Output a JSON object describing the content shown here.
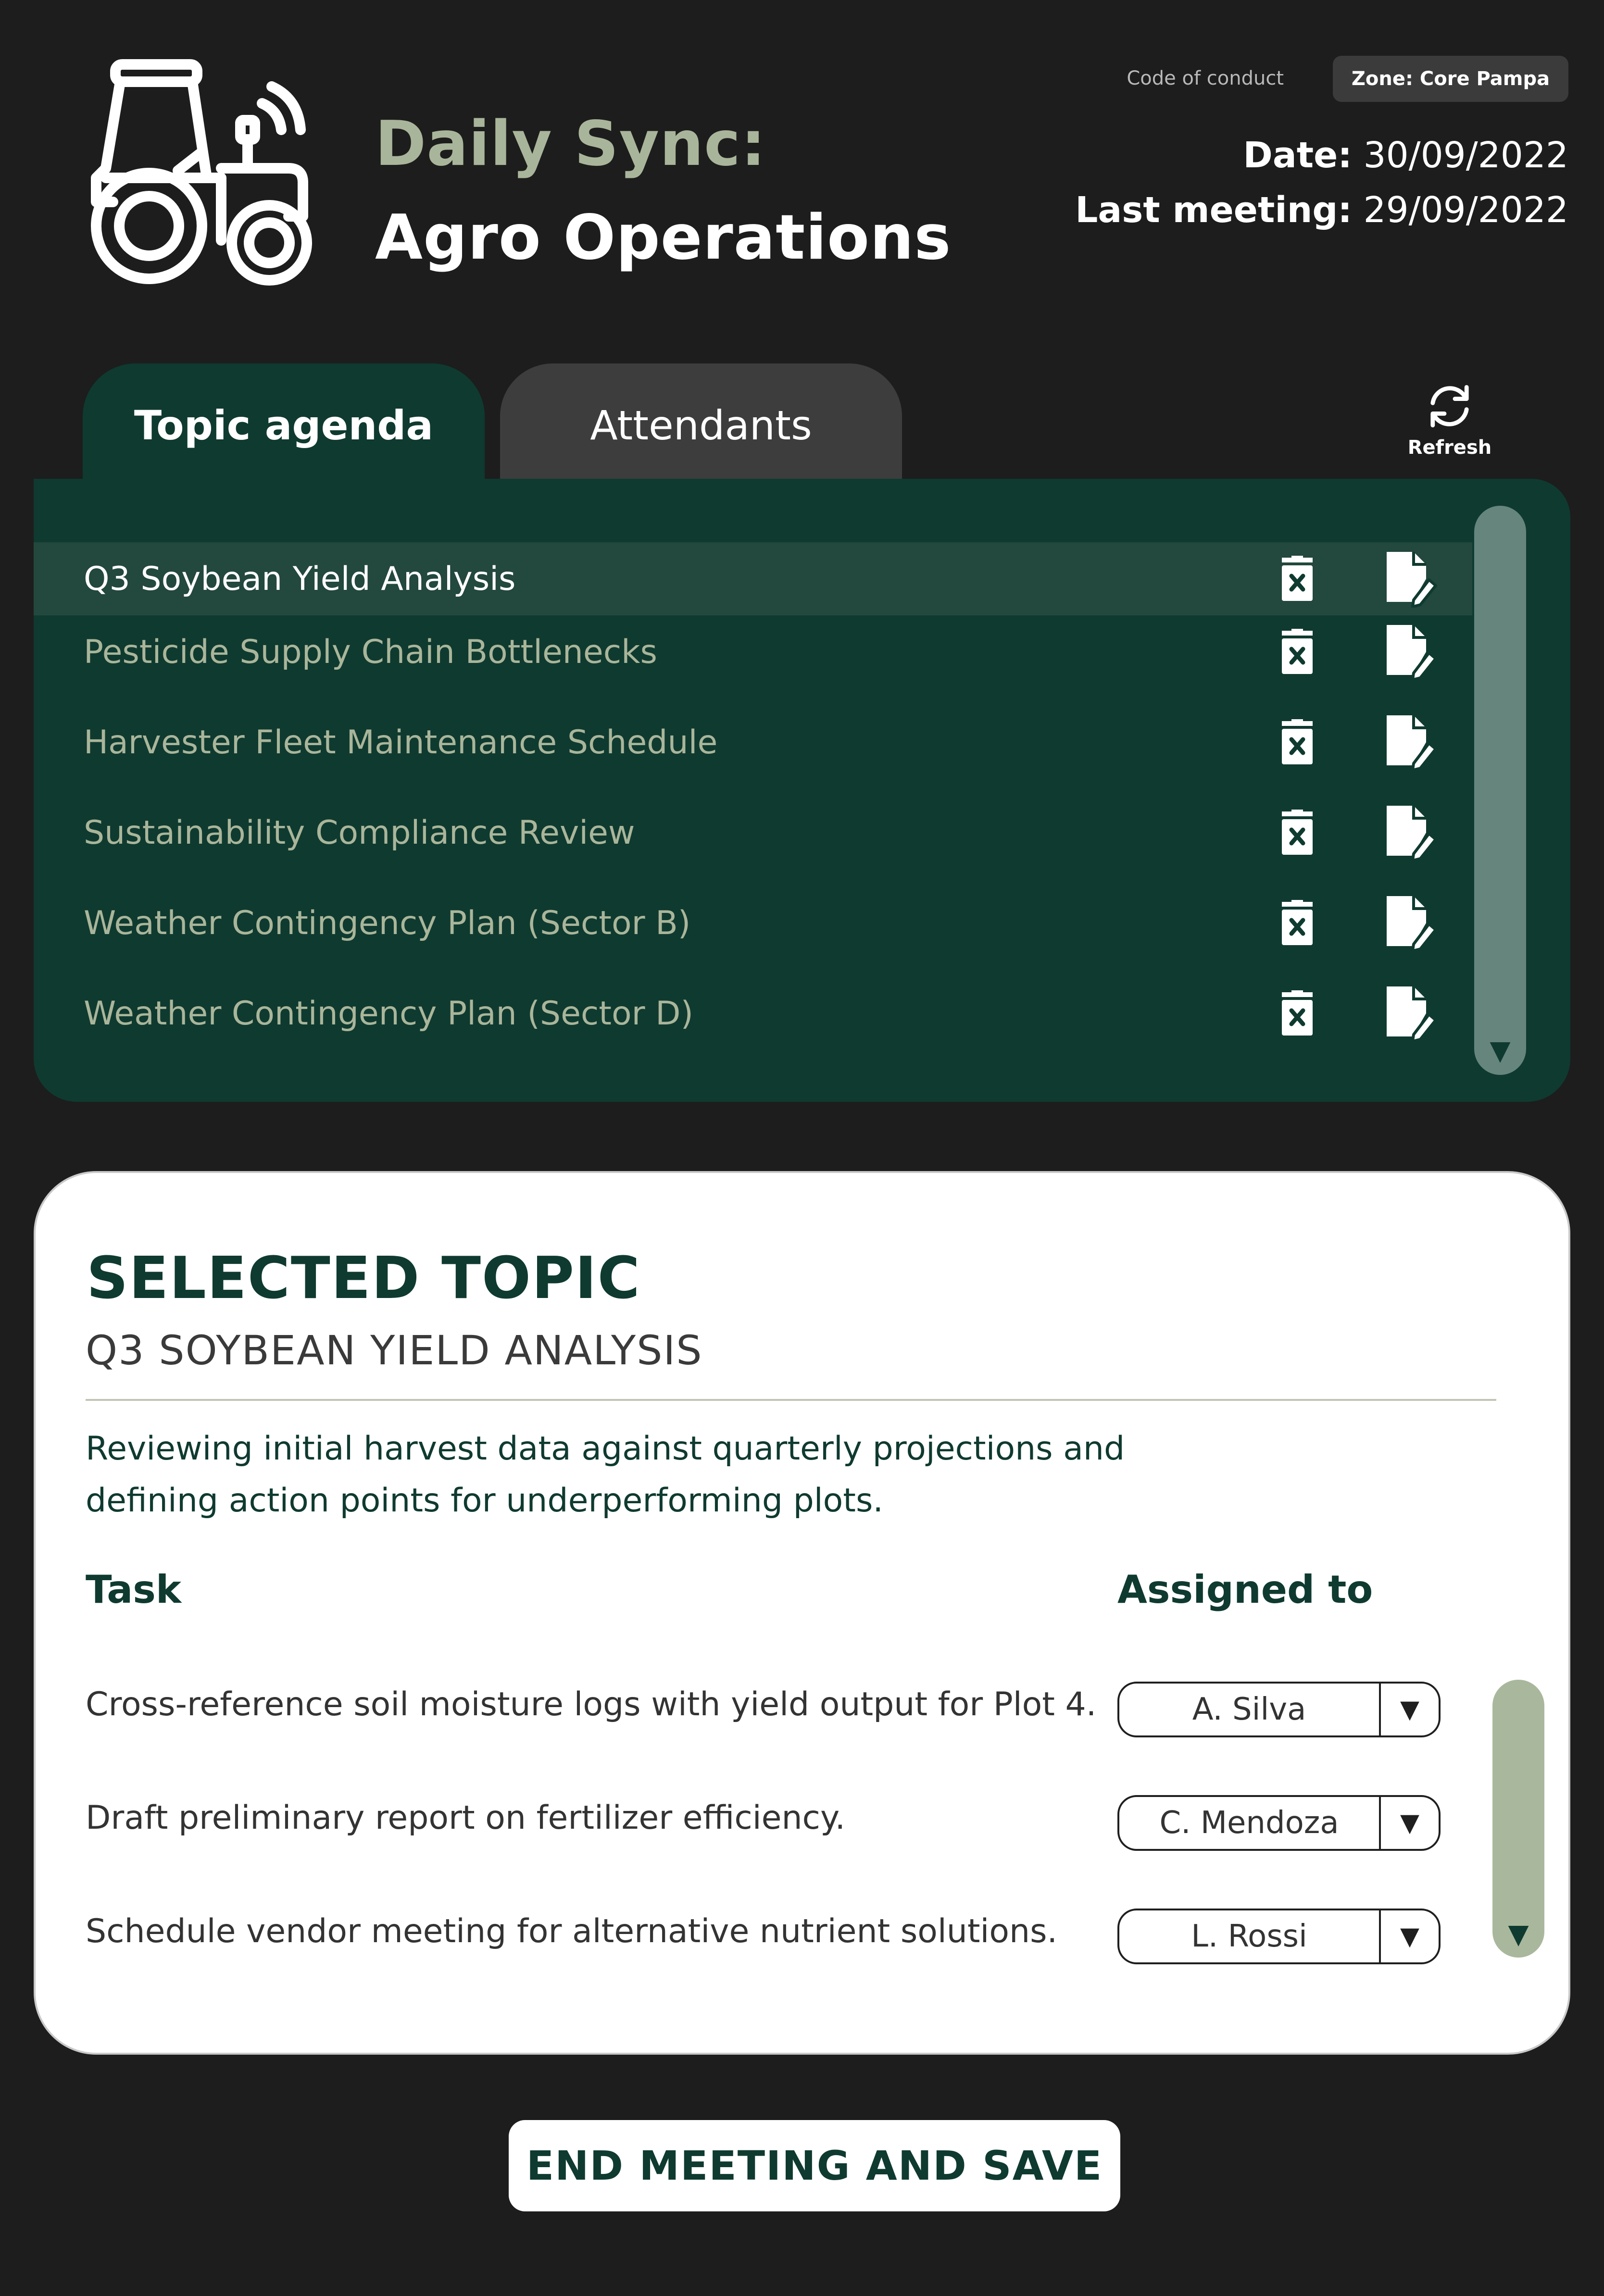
{
  "header": {
    "title_line1": "Daily Sync:",
    "title_line2": "Agro Operations",
    "code_of_conduct": "Code of conduct",
    "zone": "Zone: Core Pampa",
    "date_label": "Date:",
    "date_value": "30/09/2022",
    "last_meeting_label": "Last meeting:",
    "last_meeting_value": "29/09/2022",
    "logo_icon": "tractor-icon"
  },
  "tabs": {
    "active": "Topic agenda",
    "inactive": "Attendants"
  },
  "refresh": {
    "label": "Refresh",
    "icon": "refresh-icon"
  },
  "agenda": {
    "items": [
      {
        "label": "Q3 Soybean Yield Analysis",
        "selected": true
      },
      {
        "label": "Pesticide Supply Chain Bottlenecks",
        "selected": false
      },
      {
        "label": "Harvester Fleet Maintenance Schedule",
        "selected": false
      },
      {
        "label": "Sustainability Compliance Review",
        "selected": false
      },
      {
        "label": "Weather Contingency Plan (Sector B)",
        "selected": false
      },
      {
        "label": "Weather Contingency Plan (Sector D)",
        "selected": false
      }
    ],
    "row_icons": [
      "delete-icon",
      "edit-document-icon"
    ]
  },
  "selected_topic": {
    "heading": "SELECTED TOPIC",
    "title": "Q3 SOYBEAN YIELD ANALYSIS",
    "description": "Reviewing initial harvest data against quarterly projections and defining action points for underperforming plots.",
    "task_header": "Task",
    "assigned_header": "Assigned to",
    "tasks": [
      {
        "task": "Cross-reference soil moisture logs with yield output for Plot 4.",
        "assignee": "A. Silva"
      },
      {
        "task": "Draft preliminary report on fertilizer efficiency.",
        "assignee": "C. Mendoza"
      },
      {
        "task": "Schedule vendor meeting for alternative nutrient solutions.",
        "assignee": "L. Rossi"
      }
    ]
  },
  "footer": {
    "end_button": "END MEETING AND SAVE"
  },
  "colors": {
    "background": "#1d1d1d",
    "brand_green": "#0f3a30",
    "selected_row": "#23483e",
    "sage": "#a9b59a",
    "tab_inactive": "#3d3d3d"
  }
}
